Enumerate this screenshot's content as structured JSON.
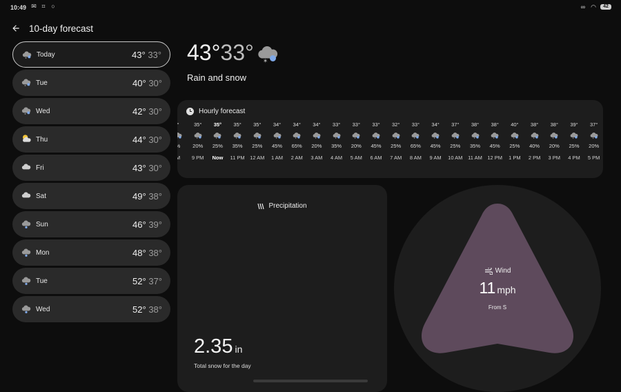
{
  "status": {
    "time": "10:49",
    "battery": "42"
  },
  "header": {
    "title": "10-day forecast"
  },
  "days": [
    {
      "name": "Today",
      "hi": "43°",
      "lo": "33°",
      "icon": "rain-snow-icon"
    },
    {
      "name": "Tue",
      "hi": "40°",
      "lo": "30°",
      "icon": "rain-snow-icon"
    },
    {
      "name": "Wed",
      "hi": "42°",
      "lo": "30°",
      "icon": "rain-snow-icon"
    },
    {
      "name": "Thu",
      "hi": "44°",
      "lo": "30°",
      "icon": "partly-sunny-icon"
    },
    {
      "name": "Fri",
      "hi": "43°",
      "lo": "30°",
      "icon": "cloudy-icon"
    },
    {
      "name": "Sat",
      "hi": "49°",
      "lo": "38°",
      "icon": "cloudy-icon"
    },
    {
      "name": "Sun",
      "hi": "46°",
      "lo": "39°",
      "icon": "rain-icon"
    },
    {
      "name": "Mon",
      "hi": "48°",
      "lo": "38°",
      "icon": "rain-icon"
    },
    {
      "name": "Tue",
      "hi": "52°",
      "lo": "37°",
      "icon": "rain-icon"
    },
    {
      "name": "Wed",
      "hi": "52°",
      "lo": "38°",
      "icon": "rain-icon"
    }
  ],
  "current": {
    "hi": "43°",
    "lo": "33°",
    "condition": "Rain and snow",
    "icon": "rain-snow-icon"
  },
  "hourly": {
    "title": "Hourly forecast",
    "items": [
      {
        "temp": "°",
        "precip": "%",
        "time": "M"
      },
      {
        "temp": "35°",
        "precip": "20%",
        "time": "9 PM"
      },
      {
        "temp": "35°",
        "precip": "25%",
        "time": "Now"
      },
      {
        "temp": "35°",
        "precip": "35%",
        "time": "11 PM"
      },
      {
        "temp": "35°",
        "precip": "25%",
        "time": "12 AM"
      },
      {
        "temp": "34°",
        "precip": "45%",
        "time": "1 AM"
      },
      {
        "temp": "34°",
        "precip": "65%",
        "time": "2 AM"
      },
      {
        "temp": "34°",
        "precip": "20%",
        "time": "3 AM"
      },
      {
        "temp": "33°",
        "precip": "35%",
        "time": "4 AM"
      },
      {
        "temp": "33°",
        "precip": "20%",
        "time": "5 AM"
      },
      {
        "temp": "33°",
        "precip": "45%",
        "time": "6 AM"
      },
      {
        "temp": "32°",
        "precip": "25%",
        "time": "7 AM"
      },
      {
        "temp": "33°",
        "precip": "65%",
        "time": "8 AM"
      },
      {
        "temp": "34°",
        "precip": "45%",
        "time": "9 AM"
      },
      {
        "temp": "37°",
        "precip": "25%",
        "time": "10 AM"
      },
      {
        "temp": "38°",
        "precip": "35%",
        "time": "11 AM"
      },
      {
        "temp": "38°",
        "precip": "45%",
        "time": "12 PM"
      },
      {
        "temp": "40°",
        "precip": "25%",
        "time": "1 PM"
      },
      {
        "temp": "38°",
        "precip": "40%",
        "time": "2 PM"
      },
      {
        "temp": "38°",
        "precip": "20%",
        "time": "3 PM"
      },
      {
        "temp": "39°",
        "precip": "25%",
        "time": "4 PM"
      },
      {
        "temp": "37°",
        "precip": "20%",
        "time": "5 PM"
      }
    ]
  },
  "precipitation": {
    "title": "Precipitation",
    "value": "2.35",
    "unit": "in",
    "description": "Total snow for the day"
  },
  "wind": {
    "title": "Wind",
    "speed": "11",
    "unit": "mph",
    "direction": "From S"
  },
  "colors": {
    "background": "#0d0d0d",
    "card": "#1d1d1d",
    "day_pill": "#2a2a2a",
    "wind_shape": "#5e4a5c"
  }
}
